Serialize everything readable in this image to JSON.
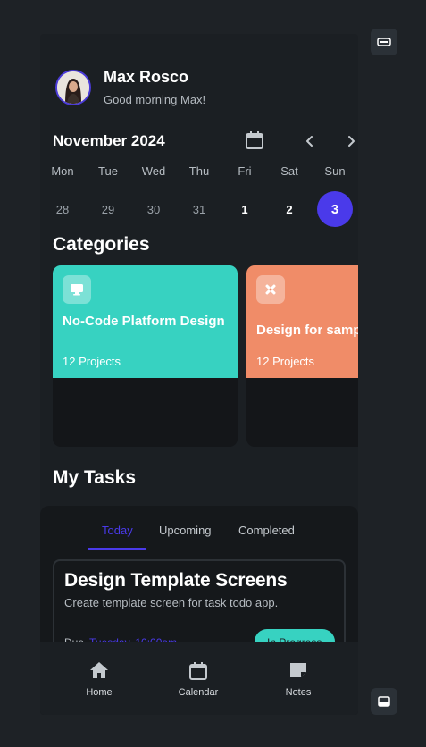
{
  "header": {
    "name": "Max Rosco",
    "greeting": "Good morning Max!"
  },
  "calendar": {
    "month_label": "November 2024",
    "days": [
      {
        "name": "Mon",
        "date": "28"
      },
      {
        "name": "Tue",
        "date": "29"
      },
      {
        "name": "Wed",
        "date": "30"
      },
      {
        "name": "Thu",
        "date": "31"
      },
      {
        "name": "Fri",
        "date": "1"
      },
      {
        "name": "Sat",
        "date": "2"
      },
      {
        "name": "Sun",
        "date": "3"
      }
    ],
    "selected_index": 6
  },
  "categories": {
    "title": "Categories",
    "items": [
      {
        "title": "No-Code Platform Design",
        "count": "12 Projects",
        "color": "#37d2c1",
        "icon": "monitor-icon"
      },
      {
        "title": "Design for samp",
        "count": "12 Projects",
        "color": "#f08c68",
        "icon": "tools-icon"
      }
    ]
  },
  "tasks": {
    "title": "My Tasks",
    "tabs": [
      "Today",
      "Upcoming",
      "Completed"
    ],
    "active_tab": "Today",
    "card": {
      "title": "Design Template Screens",
      "description": "Create template screen for task todo app.",
      "due_label": "Due",
      "due_time": "Tuesday, 10:00am",
      "status": "In Progress"
    }
  },
  "bottom_nav": {
    "items": [
      {
        "label": "Home",
        "icon": "home-icon"
      },
      {
        "label": "Calendar",
        "icon": "calendar-icon"
      },
      {
        "label": "Notes",
        "icon": "notes-icon"
      }
    ]
  },
  "colors": {
    "accent": "#4a3aea",
    "teal": "#37d2c1",
    "orange": "#f08c68",
    "background": "#1b1f23"
  }
}
